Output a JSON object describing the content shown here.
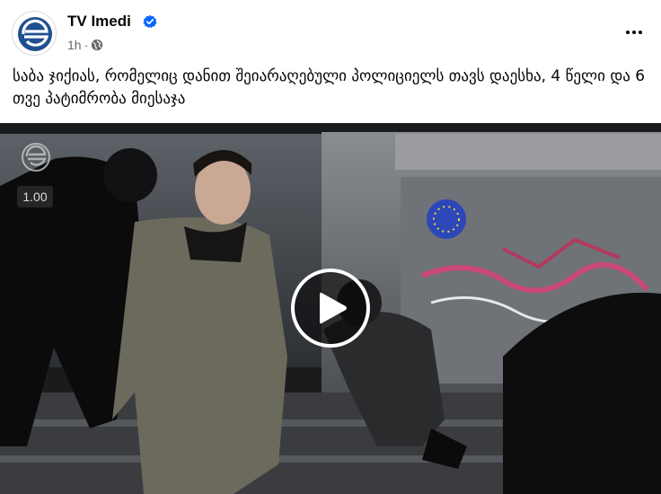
{
  "post": {
    "page_name": "TV Imedi",
    "time": "1h",
    "dot": "·",
    "caption": "საბა ჯიქიას, რომელიც დანით შეიარაღებული პოლიციელს თავს დაესხა, 4 წელი და 6 თვე პატიმრობა მიესაჯა"
  },
  "video": {
    "playback_speed": "1.00",
    "watermark_icon": "imedi-logo-icon",
    "play_icon": "play-icon"
  },
  "icons": {
    "verified": "verified-badge-icon",
    "privacy": "globe-icon",
    "more": "more-options-icon"
  },
  "colors": {
    "verified_blue": "#0866ff",
    "secondary_text": "#65676b",
    "logo_blue": "#1f4f8f"
  }
}
